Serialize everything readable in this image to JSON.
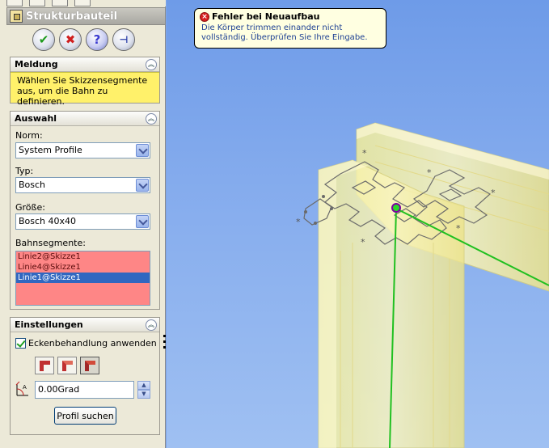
{
  "panel": {
    "title": "Strukturbauteil"
  },
  "groups": {
    "message": {
      "title": "Meldung",
      "text": "Wählen Sie Skizzensegmente aus, um die Bahn zu definieren."
    },
    "selection": {
      "title": "Auswahl",
      "norm_label": "Norm:",
      "norm_value": "System Profile",
      "type_label": "Typ:",
      "type_value": "Bosch",
      "size_label": "Größe:",
      "size_value": "Bosch 40x40",
      "segments_label": "Bahnsegmente:",
      "segments": [
        "Linie2@Skizze1",
        "Linie4@Skizze1",
        "Linie1@Skizze1"
      ],
      "selected_segment_index": 2
    },
    "settings": {
      "title": "Einstellungen",
      "corner_checkbox_label": "Eckenbehandlung anwenden",
      "corner_checkbox_checked": true,
      "angle_value": "0.00Grad",
      "find_profile_label": "Profil suchen"
    }
  },
  "tooltip": {
    "title": "Fehler bei Neuaufbau",
    "body": "Die Körper trimmen einander nicht vollständig. Überprüfen Sie Ihre Eingabe."
  },
  "colors": {
    "message_bg": "#fff16a",
    "segment_list_bg": "#fe8686",
    "selection_blue": "#3167c0",
    "tooltip_bg": "#ffffe1",
    "viewport_sky": "#84abed",
    "profile_yellow": "#f7f0a0",
    "path_green": "#20c020"
  },
  "icons": {
    "ok": "check-icon",
    "cancel": "x-icon",
    "help": "question-icon",
    "pin": "pushpin-icon",
    "error": "error-icon"
  }
}
